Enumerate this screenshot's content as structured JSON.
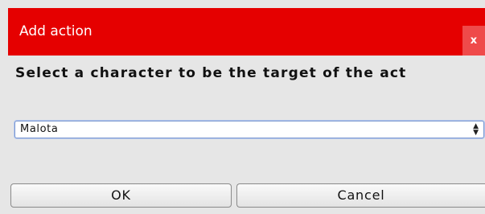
{
  "window": {
    "title": "Add action",
    "close_label": "x"
  },
  "prompt": {
    "text": "Select a character to be the target of the act"
  },
  "character_select": {
    "selected_value": "Malota",
    "arrow_icon": "up-down-arrows-icon"
  },
  "buttons": {
    "ok_label": "OK",
    "cancel_label": "Cancel"
  },
  "colors": {
    "titlebar": "#e50000",
    "background": "#e6e6e6",
    "select_border": "#7a97cf"
  }
}
